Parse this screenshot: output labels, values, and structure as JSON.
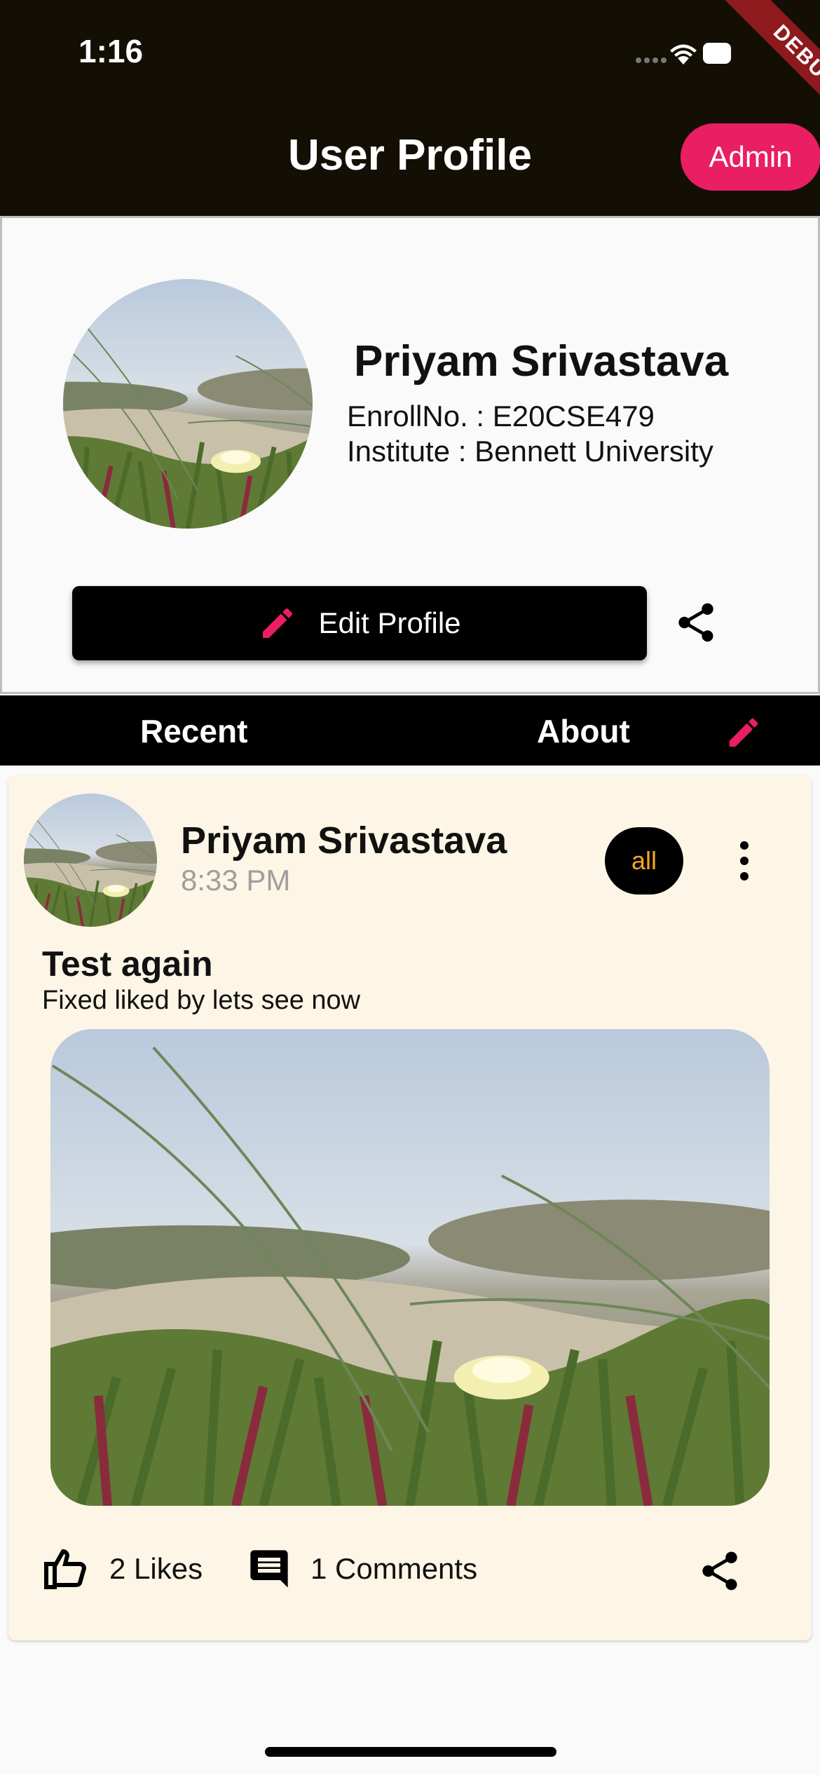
{
  "status_bar": {
    "time": "1:16"
  },
  "app_bar": {
    "title": "User Profile",
    "admin_label": "Admin",
    "debug_label": "DEBUG"
  },
  "profile": {
    "name": "Priyam Srivastava",
    "enroll": "EnrollNo. : E20CSE479",
    "institute": "Institute : Bennett University",
    "edit_label": "Edit Profile"
  },
  "tabs": [
    {
      "label": "Recent"
    },
    {
      "label": "About"
    }
  ],
  "post": {
    "author": "Priyam Srivastava",
    "time": "8:33 PM",
    "audience": "all",
    "title": "Test again",
    "body": "Fixed liked by lets see now",
    "likes": "2 Likes",
    "comments": "1 Comments"
  },
  "colors": {
    "accent": "#e91e63",
    "appbar": "#130f05",
    "card": "#fdf5e6",
    "badge_text": "#f5a623"
  },
  "icons": [
    "wifi-icon",
    "battery-icon",
    "pencil-icon",
    "share-icon",
    "more-vert-icon",
    "thumb-up-icon",
    "comment-icon"
  ]
}
